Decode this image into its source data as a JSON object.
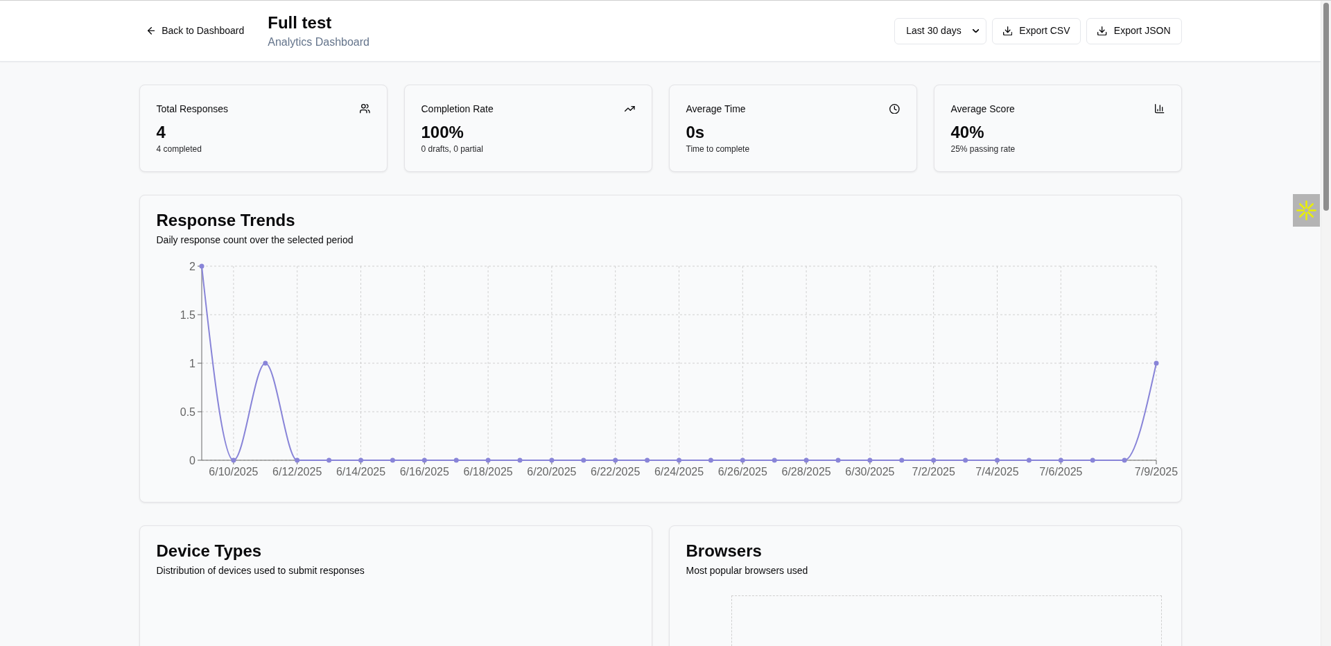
{
  "header": {
    "back_link": "Back to Dashboard",
    "title": "Full test",
    "subtitle": "Analytics Dashboard",
    "date_range": {
      "value": "Last 30 days"
    },
    "actions": [
      {
        "label": "Export CSV"
      },
      {
        "label": "Export JSON"
      }
    ]
  },
  "stats": [
    {
      "kind": "count",
      "title": "Total Responses",
      "value": "4",
      "detail": "4 completed"
    },
    {
      "kind": "rate",
      "title": "Completion Rate",
      "value": "100%",
      "detail": "0 drafts, 0 partial"
    },
    {
      "kind": "time",
      "title": "Average Time",
      "value": "0s",
      "detail": "Time to complete"
    },
    {
      "kind": "score",
      "title": "Average Score",
      "value": "40%",
      "detail": "25% passing rate"
    }
  ],
  "response_trends": {
    "title": "Response Trends",
    "subtitle": "Daily response count over the selected period",
    "chart_data": {
      "type": "line",
      "categories": [
        null,
        "6/10/2025",
        null,
        "6/12/2025",
        null,
        "6/14/2025",
        null,
        "6/16/2025",
        null,
        "6/18/2025",
        null,
        "6/20/2025",
        null,
        "6/22/2025",
        null,
        "6/24/2025",
        null,
        "6/26/2025",
        null,
        "6/28/2025",
        null,
        "6/30/2025",
        null,
        "7/2/2025",
        null,
        "7/4/2025",
        null,
        "7/6/2025",
        null,
        null,
        "7/9/2025"
      ],
      "series": [
        {
          "color": "#8884d8",
          "marker": "circle",
          "values": [
            2,
            0,
            1,
            0,
            0,
            0,
            0,
            0,
            0,
            0,
            0,
            0,
            0,
            0,
            0,
            0,
            0,
            0,
            0,
            0,
            0,
            0,
            0,
            0,
            0,
            0,
            0,
            0,
            0,
            0,
            1
          ]
        }
      ],
      "ylim": [
        0,
        2
      ],
      "yticks": [
        0,
        0.5,
        1,
        1.5,
        2
      ],
      "grid": true
    }
  },
  "device_types": {
    "title": "Device Types",
    "subtitle": "Distribution of devices used to submit responses"
  },
  "browsers": {
    "title": "Browsers",
    "subtitle": "Most popular browsers used"
  }
}
